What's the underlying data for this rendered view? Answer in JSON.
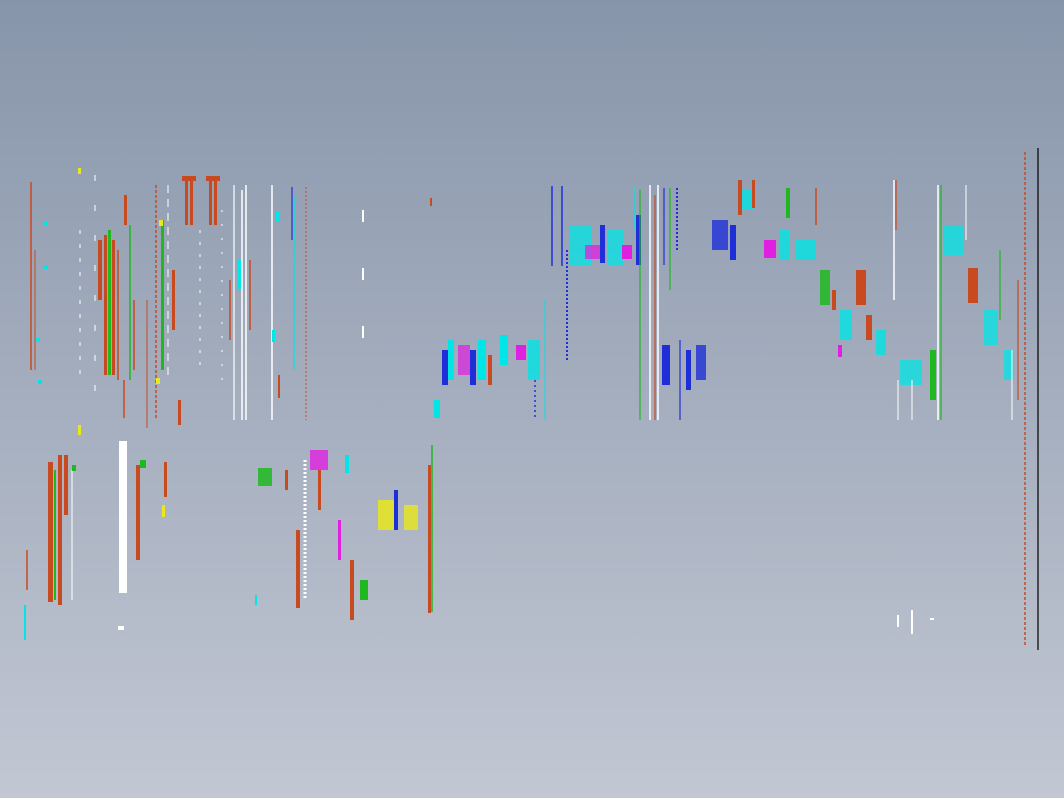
{
  "viewport": {
    "background_top": "#8795aa",
    "background_bottom": "#c2c7d3"
  },
  "palette": {
    "red": "#c84a20",
    "green": "#1fb81f",
    "cyan": "#00e5e5",
    "blue": "#1f2fd8",
    "magenta": "#e020e0",
    "yellow": "#e8e81c",
    "white": "#ffffff",
    "black": "#000000"
  },
  "drawing": {
    "content": "cad-drawing-lines",
    "visible_text": []
  }
}
